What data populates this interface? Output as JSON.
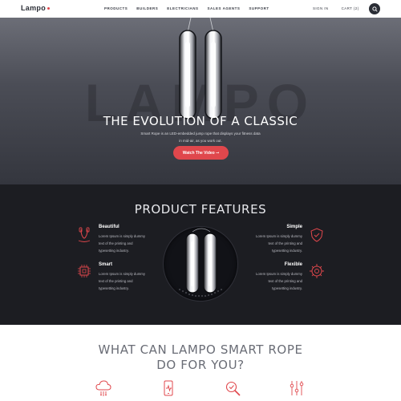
{
  "nav": {
    "logo": "Lampo",
    "menu": [
      "PRODUCTS",
      "BUILDERS",
      "ELECTRICIANS",
      "SALES AGENTS",
      "SUPPORT"
    ],
    "sign_in": "SIGN IN",
    "cart": "CART (2)"
  },
  "hero": {
    "watermark": "LAMPO",
    "title": "THE EVOLUTION OF A CLASSIC",
    "subtitle_line1": "Smart Rope is an LED-embedded jump rope that displays your fitness data",
    "subtitle_line2": "in mid-air, as you work out.",
    "cta": "Watch The Video ➞"
  },
  "features": {
    "title": "PRODUCT FEATURES",
    "items": [
      {
        "name": "Beautiful",
        "line1": "Lorem Ipsum is simply dummy",
        "line2": "text of the printing and",
        "line3": "typesetting industry."
      },
      {
        "name": "Smart",
        "line1": "Lorem Ipsum is simply dummy",
        "line2": "text of the printing and",
        "line3": "typesetting industry."
      },
      {
        "name": "Simple",
        "line1": "Lorem Ipsum is simply dummy",
        "line2": "text of the printing and",
        "line3": "typesetting industry."
      },
      {
        "name": "Flexible",
        "line1": "Lorem Ipsum is simply dummy",
        "line2": "text of the printing and",
        "line3": "typesetting industry."
      }
    ]
  },
  "what": {
    "title_line1": "WHAT CAN LAMPO SMART ROPE",
    "title_line2": "DO FOR YOU?"
  },
  "colors": {
    "accent": "#e0474c",
    "dark": "#1c1d22",
    "hero": "#4b4d56"
  },
  "icons": [
    "search-icon",
    "jump-rope-icon",
    "chip-icon",
    "shield-check-icon",
    "flexible-gear-icon",
    "cloud-icon",
    "phone-icon",
    "search-check-icon",
    "sliders-icon"
  ]
}
